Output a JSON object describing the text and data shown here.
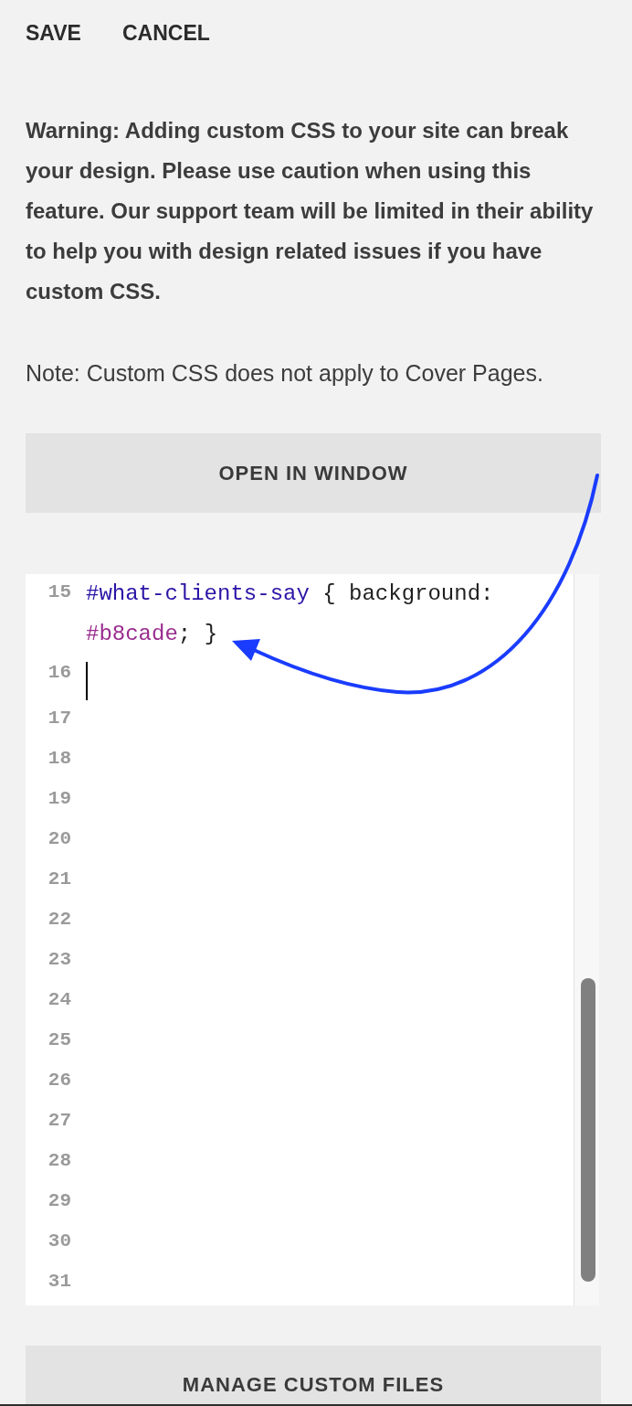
{
  "toolbar": {
    "buttons": [
      {
        "label": "SAVE"
      },
      {
        "label": "CANCEL"
      }
    ]
  },
  "warning": "Warning: Adding custom CSS to your site can break your design. Please use caution when using this feature. Our support team will be limited in their ability to help you with design related issues if you have custom CSS.",
  "note": "Note: Custom CSS does not apply to Cover Pages.",
  "open_button": {
    "label": "OPEN IN WINDOW"
  },
  "editor": {
    "lines": [
      {
        "number": "15",
        "cursor": false,
        "tokens": [
          {
            "text": "#what-clients-say",
            "kind": "selector"
          },
          {
            "text": " { background: ",
            "kind": "plain"
          },
          {
            "text": "#b8cade",
            "kind": "value"
          },
          {
            "text": "; }",
            "kind": "plain"
          }
        ]
      },
      {
        "number": "16",
        "cursor": true
      },
      {
        "number": "17",
        "cursor": false
      },
      {
        "number": "18",
        "cursor": false
      },
      {
        "number": "19",
        "cursor": false
      },
      {
        "number": "20",
        "cursor": false
      },
      {
        "number": "21",
        "cursor": false
      },
      {
        "number": "22",
        "cursor": false
      },
      {
        "number": "23",
        "cursor": false
      },
      {
        "number": "24",
        "cursor": false
      },
      {
        "number": "25",
        "cursor": false
      },
      {
        "number": "26",
        "cursor": false
      },
      {
        "number": "27",
        "cursor": false
      },
      {
        "number": "28",
        "cursor": false
      },
      {
        "number": "29",
        "cursor": false
      },
      {
        "number": "30",
        "cursor": false
      },
      {
        "number": "31",
        "cursor": false
      }
    ]
  },
  "annotation": {
    "kind": "arrow"
  },
  "manage_button": {
    "label": "MANAGE CUSTOM FILES"
  }
}
